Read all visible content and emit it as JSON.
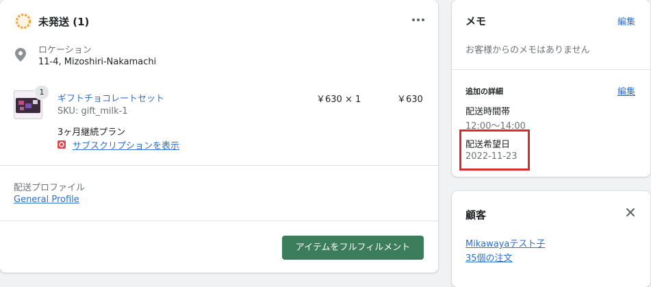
{
  "order_card": {
    "status_title": "未発送 (1)",
    "more_icon": "more-horizontal-icon",
    "location_label": "ロケーション",
    "location_value": "11-4, Mizoshiri-Nakamachi",
    "item": {
      "quantity_badge": "1",
      "name": "ギフトチョコレートセット",
      "sku": "SKU: gift_milk-1",
      "price_qty": "￥630 × 1",
      "total": "￥630",
      "plan": "3ヶ月継続プラン",
      "subscription_link": "サブスクリプションを表示"
    },
    "shipping_profile_label": "配送プロファイル",
    "shipping_profile_link": "General Profile",
    "fulfill_button": "アイテムをフルフィルメント"
  },
  "memo_card": {
    "title": "メモ",
    "edit_label": "編集",
    "empty_text": "お客様からのメモはありません",
    "additional_title": "追加の詳細",
    "additional_edit": "編集",
    "time_label": "配送時間帯",
    "time_value": "12:00〜14:00",
    "date_label": "配送希望日",
    "date_value": "2022-11-23"
  },
  "customer_card": {
    "title": "顧客",
    "close_icon": "close-icon",
    "customer_name": "Mikawayaテスト子",
    "orders_count": "35個の注文"
  },
  "colors": {
    "primary_button": "#3c7d5c",
    "link": "#2c6ecb",
    "highlight": "#d92b2b",
    "status_ring": "#e8a33d"
  }
}
